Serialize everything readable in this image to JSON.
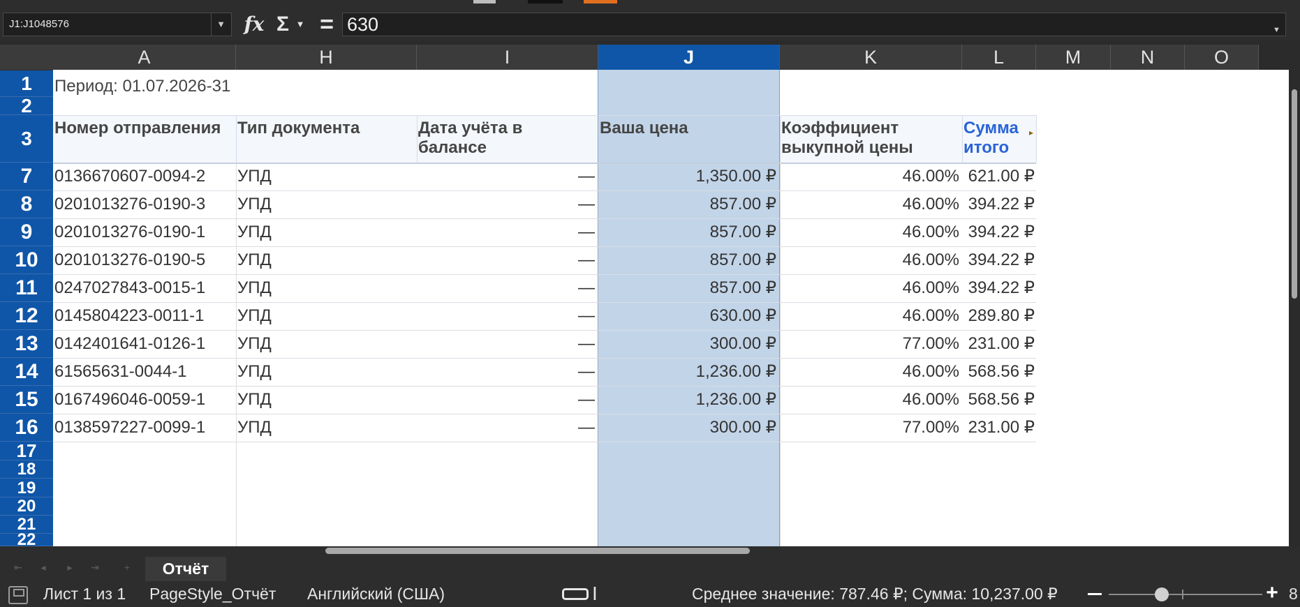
{
  "formula_bar": {
    "name_box": "J1:J1048576",
    "fx_icon": "function-wizard-icon",
    "sum_icon": "sigma-icon",
    "formula_icon": "equals-icon",
    "sum_glyph": "Σ",
    "eq_glyph": "=",
    "value": "630"
  },
  "columns": [
    {
      "label": "A",
      "selected": false
    },
    {
      "label": "H",
      "selected": false
    },
    {
      "label": "I",
      "selected": false
    },
    {
      "label": "J",
      "selected": true
    },
    {
      "label": "K",
      "selected": false
    },
    {
      "label": "L",
      "selected": false
    },
    {
      "label": "M",
      "selected": false
    },
    {
      "label": "N",
      "selected": false
    },
    {
      "label": "O",
      "selected": false
    }
  ],
  "row_numbers": [
    "1",
    "2",
    "3",
    "7",
    "8",
    "9",
    "10",
    "11",
    "12",
    "13",
    "14",
    "15",
    "16",
    "17",
    "18",
    "19",
    "20",
    "21",
    "22"
  ],
  "period": "Период: 01.07.2026-31",
  "headers": {
    "a": "Номер отправления",
    "h": "Тип документа",
    "i": "Дата учёта в балансе",
    "j": "Ваша цена",
    "k": "Коэффициент выкупной цены",
    "l": "Сумма итого"
  },
  "rows": [
    {
      "a": "0136670607-0094-2",
      "h": "УПД",
      "i": "—",
      "j": "1,350.00 ₽",
      "k": "46.00%",
      "l": "621.00 ₽"
    },
    {
      "a": "0201013276-0190-3",
      "h": "УПД",
      "i": "—",
      "j": "857.00 ₽",
      "k": "46.00%",
      "l": "394.22 ₽"
    },
    {
      "a": "0201013276-0190-1",
      "h": "УПД",
      "i": "—",
      "j": "857.00 ₽",
      "k": "46.00%",
      "l": "394.22 ₽"
    },
    {
      "a": "0201013276-0190-5",
      "h": "УПД",
      "i": "—",
      "j": "857.00 ₽",
      "k": "46.00%",
      "l": "394.22 ₽"
    },
    {
      "a": "0247027843-0015-1",
      "h": "УПД",
      "i": "—",
      "j": "857.00 ₽",
      "k": "46.00%",
      "l": "394.22 ₽"
    },
    {
      "a": "0145804223-0011-1",
      "h": "УПД",
      "i": "—",
      "j": "630.00 ₽",
      "k": "46.00%",
      "l": "289.80 ₽"
    },
    {
      "a": "0142401641-0126-1",
      "h": "УПД",
      "i": "—",
      "j": "300.00 ₽",
      "k": "77.00%",
      "l": "231.00 ₽"
    },
    {
      "a": "61565631-0044-1",
      "h": "УПД",
      "i": "—",
      "j": "1,236.00 ₽",
      "k": "46.00%",
      "l": "568.56 ₽"
    },
    {
      "a": "0167496046-0059-1",
      "h": "УПД",
      "i": "—",
      "j": "1,236.00 ₽",
      "k": "46.00%",
      "l": "568.56 ₽"
    },
    {
      "a": "0138597227-0099-1",
      "h": "УПД",
      "i": "—",
      "j": "300.00 ₽",
      "k": "77.00%",
      "l": "231.00 ₽"
    }
  ],
  "sheet_tab": "Отчёт",
  "status": {
    "sheet": "Лист 1 из 1",
    "page_style": "PageStyle_Отчёт",
    "language": "Английский (США)",
    "summary": "Среднее значение: 787.46 ₽; Сумма: 10,237.00 ₽",
    "zoom_partial": "8"
  },
  "colors": {
    "selection_header": "#0f56a8",
    "selection_fill": "#c2d4e8",
    "header_accent": "#2a64d6"
  }
}
